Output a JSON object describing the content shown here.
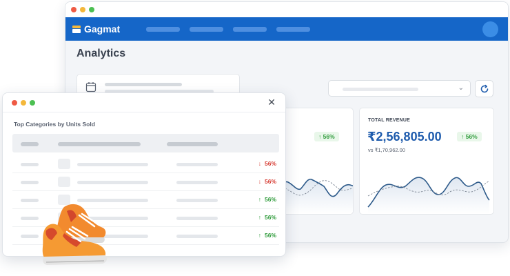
{
  "app": {
    "brand": "Gagmat"
  },
  "page": {
    "title": "Analytics"
  },
  "cards": {
    "left": {
      "badge": "↑ 56%"
    },
    "right": {
      "label": "TOTAL REVENUE",
      "value": "₹2,56,805.00",
      "comparison": "vs ₹1,70,962.00",
      "badge": "↑ 56%"
    }
  },
  "panel": {
    "title": "Top Categories by Units Sold",
    "rows": [
      {
        "direction": "down",
        "arrow": "↓",
        "change": "56%"
      },
      {
        "direction": "down",
        "arrow": "↓",
        "change": "56%"
      },
      {
        "direction": "up",
        "arrow": "↑",
        "change": "56%"
      },
      {
        "direction": "up",
        "arrow": "↑",
        "change": "56%"
      },
      {
        "direction": "up",
        "arrow": "↑",
        "change": "56%"
      }
    ]
  },
  "icons": {
    "calendar": "calendar-icon",
    "refresh": "refresh-icon",
    "dropdown": "chevron-down-icon",
    "close": "close-icon",
    "illustration": "sneaker-illustration"
  },
  "colors": {
    "brand": "#1566c8",
    "accent": "#1f5cad",
    "positive": "#2f9b3b",
    "negative": "#d63b32"
  }
}
